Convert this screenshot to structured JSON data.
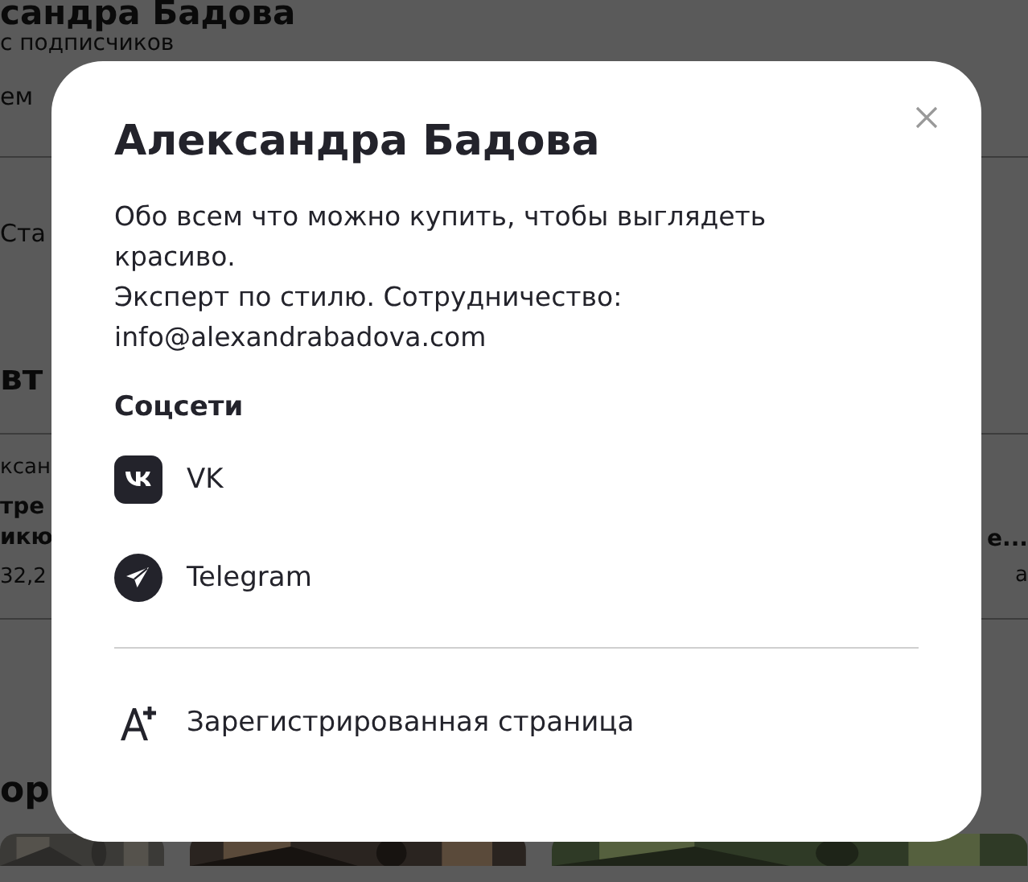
{
  "background": {
    "heading": "сандра Бадова",
    "subtitle": "с подписчиков",
    "line_3": "ем",
    "tab": "Ста",
    "section_title": "вт",
    "card": {
      "author": "ксан",
      "title_lines": [
        "тре",
        "икю"
      ],
      "meta": "32,2",
      "right_title": "е...",
      "right_meta": "а"
    },
    "section_title_2": "ор"
  },
  "modal": {
    "title": "Александра Бадова",
    "description": [
      "Обо всем что можно купить, чтобы выглядеть",
      "красиво.",
      "Эксперт по стилю. Сотрудничество:",
      "info@alexandrabadova.com"
    ],
    "socials_title": "Соцсети",
    "socials": [
      {
        "kind": "vk",
        "label": "VK"
      },
      {
        "kind": "telegram",
        "label": "Telegram"
      }
    ],
    "badge": {
      "kind": "registered",
      "label": "Зарегистрированная страница"
    }
  }
}
